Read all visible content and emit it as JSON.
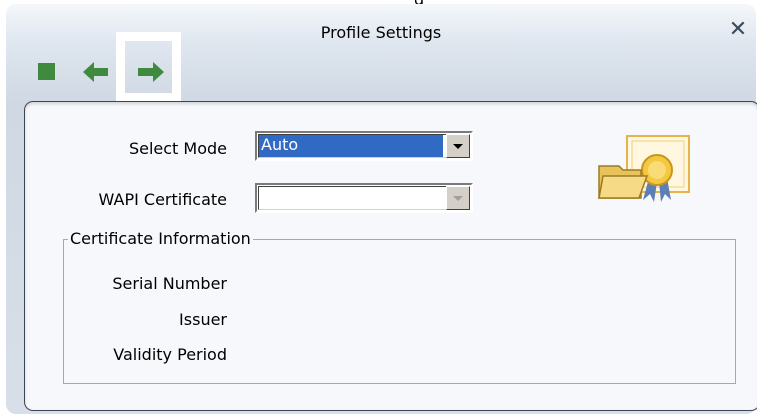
{
  "window": {
    "title": "Profile Settings"
  },
  "toolbar": {
    "stop_icon": "stop-square-icon",
    "back_icon": "back-arrow-icon",
    "next_icon": "next-arrow-icon",
    "accent_color": "#3f8a3f"
  },
  "close_icon": "close-x-icon",
  "form": {
    "select_mode_label": "Select Mode",
    "select_mode_value": "Auto",
    "wapi_cert_label": "WAPI Certificate",
    "wapi_cert_value": ""
  },
  "cert_info": {
    "legend": "Certificate Information",
    "serial_label": "Serial Number",
    "issuer_label": "Issuer",
    "validity_label": "Validity Period"
  },
  "decor": {
    "certificate_icon": "folder-certificate-icon"
  }
}
